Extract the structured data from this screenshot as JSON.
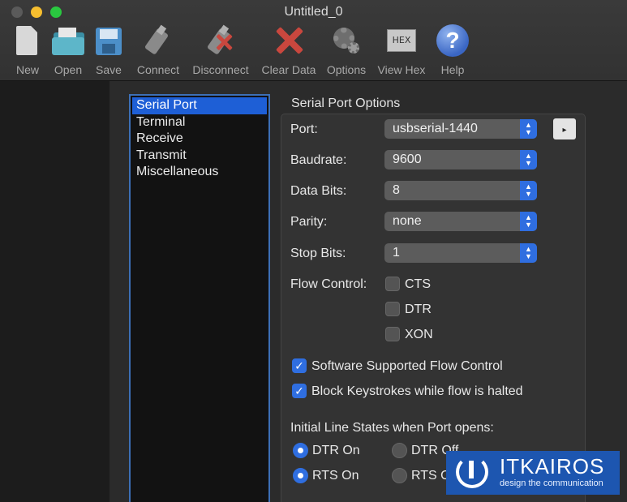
{
  "window": {
    "title": "Untitled_0"
  },
  "toolbar": {
    "items": [
      {
        "label": "New",
        "icon": "new-document-icon"
      },
      {
        "label": "Open",
        "icon": "open-folder-icon"
      },
      {
        "label": "Save",
        "icon": "save-disk-icon"
      },
      {
        "label": "Connect",
        "icon": "connect-plug-icon"
      },
      {
        "label": "Disconnect",
        "icon": "disconnect-plug-icon"
      },
      {
        "label": "Clear Data",
        "icon": "clear-x-icon"
      },
      {
        "label": "Options",
        "icon": "gears-icon"
      },
      {
        "label": "View Hex",
        "icon": "hex-icon"
      },
      {
        "label": "Help",
        "icon": "help-icon"
      }
    ],
    "hex_glyph": "HEX",
    "help_glyph": "?"
  },
  "sidebar": {
    "items": [
      {
        "label": "Serial Port",
        "selected": true
      },
      {
        "label": "Terminal",
        "selected": false
      },
      {
        "label": "Receive",
        "selected": false
      },
      {
        "label": "Transmit",
        "selected": false
      },
      {
        "label": "Miscellaneous",
        "selected": false
      }
    ]
  },
  "options": {
    "title": "Serial Port Options",
    "port_label": "Port:",
    "port_value": "usbserial-1440",
    "baud_label": "Baudrate:",
    "baud_value": "9600",
    "databits_label": "Data Bits:",
    "databits_value": "8",
    "parity_label": "Parity:",
    "parity_value": "none",
    "stopbits_label": "Stop Bits:",
    "stopbits_value": "1",
    "flow_label": "Flow Control:",
    "flow_cts": "CTS",
    "flow_dtr": "DTR",
    "flow_xon": "XON",
    "soft_flow": "Software Supported Flow Control",
    "block_keys": "Block Keystrokes while flow is halted",
    "line_states_title": "Initial Line States when Port opens:",
    "dtr_on": "DTR On",
    "dtr_off": "DTR Off",
    "rts_on": "RTS On",
    "rts_off": "RTS Off",
    "more_arrow": "▸",
    "popup_arrows": "▲▼"
  },
  "watermark": {
    "name": "ITKAIROS",
    "tagline": "design the communication"
  },
  "colors": {
    "accent": "#2f6ee0",
    "selection": "#1e5fd6",
    "watermark_bg": "#1d56b0"
  }
}
